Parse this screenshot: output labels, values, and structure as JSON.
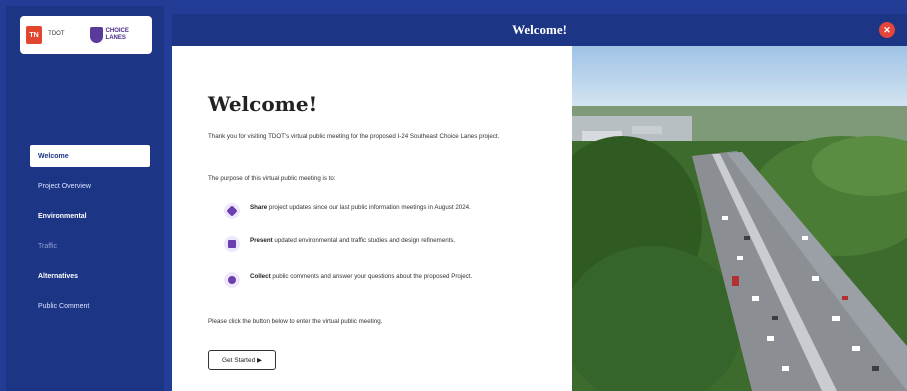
{
  "app": {
    "logo_left_mark": "TN",
    "logo_left_text": "TDOT",
    "logo_right_text": "CHOICE LANES"
  },
  "header": {
    "title": "Welcome!"
  },
  "sidebar": {
    "items": [
      {
        "label": "Welcome",
        "state": "active"
      },
      {
        "label": "Project Overview",
        "state": "normal"
      },
      {
        "label": "Environmental",
        "state": "bold"
      },
      {
        "label": "Traffic",
        "state": "dim"
      },
      {
        "label": "Alternatives",
        "state": "bold"
      },
      {
        "label": "Public Comment",
        "state": "normal"
      }
    ]
  },
  "main": {
    "heading": "Welcome!",
    "intro": "Thank you for visiting TDOT's virtual public meeting for the proposed I-24 Southeast Choice Lanes project.",
    "purpose_intro": "The purpose of this virtual public meeting is to:",
    "bullets": [
      {
        "lead": "Share",
        "text": " project updates since our last public information meetings in August 2024."
      },
      {
        "lead": "Present",
        "text": " updated environmental and traffic studies and design refinements."
      },
      {
        "lead": "Collect",
        "text": " public comments and answer your questions about the proposed Project."
      }
    ],
    "closing": "Please click the button below to enter the virtual public meeting.",
    "cta_label": "Get Started ▶"
  },
  "icons": {
    "close": "close-icon",
    "bullet1": "share-icon",
    "bullet2": "present-icon",
    "bullet3": "collect-icon"
  },
  "colors": {
    "primary": "#1d3585",
    "accent": "#6a3fb0",
    "close": "#e4463b"
  }
}
